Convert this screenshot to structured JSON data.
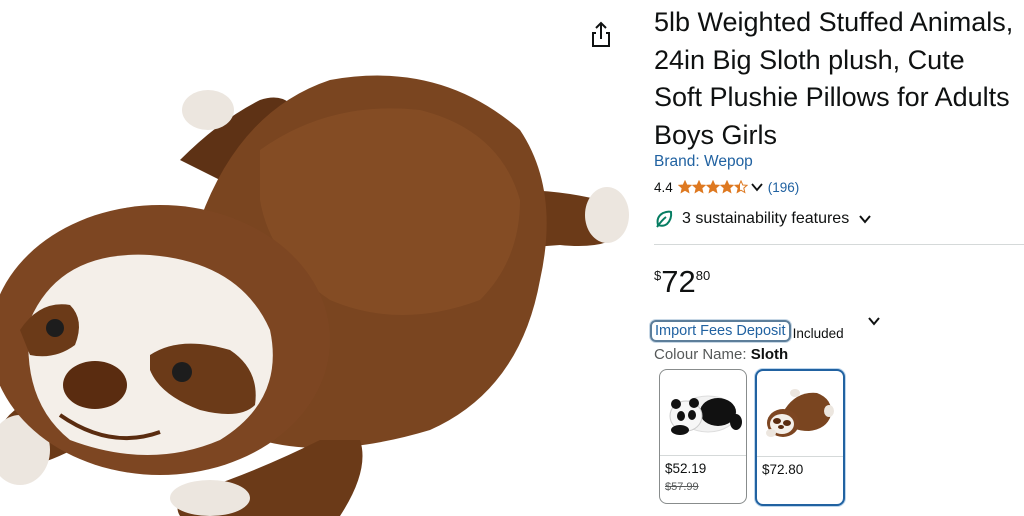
{
  "product": {
    "title": "5lb Weighted Stuffed Animals, 24in Big Sloth plush, Cute Soft Plushie Pillows for Adults Boys Girls",
    "brand_label": "Brand: Wepop",
    "rating_value": "4.4",
    "rating_stars": 4.4,
    "review_count": "(196)",
    "sustainability_text": "3 sustainability features"
  },
  "price": {
    "symbol": "$",
    "whole": "72",
    "fraction": "80"
  },
  "fees": {
    "link_text": "Import Fees Deposit",
    "included_text": "Included"
  },
  "colour": {
    "label": "Colour Name: ",
    "selected_value": "Sloth"
  },
  "swatches": [
    {
      "name": "Panda",
      "price": "$52.19",
      "list_price": "$57.99",
      "selected": false
    },
    {
      "name": "Sloth",
      "price": "$72.80",
      "list_price": "",
      "selected": true
    }
  ],
  "icons": {
    "share": "share-icon",
    "leaf": "leaf-icon",
    "chevron": "chevron-down-icon",
    "star": "star-icon"
  },
  "colors": {
    "link": "#2162a1",
    "star": "#de7921",
    "text": "#0f1111",
    "leaf": "#067d62"
  }
}
